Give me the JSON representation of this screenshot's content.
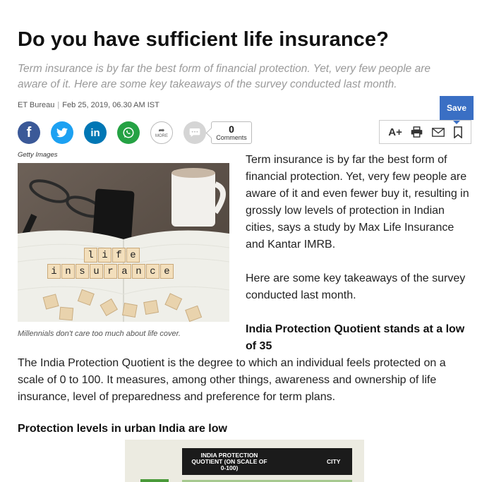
{
  "article": {
    "headline": "Do you have sufficient life insurance?",
    "synopsis": "Term insurance is by far the best form of financial protection. Yet, very few people are aware of it. Here are some key takeaways of the survey conducted last month.",
    "author": "ET Bureau",
    "date": "Feb 25, 2019, 06.30 AM IST"
  },
  "share": {
    "more_label": "MORE",
    "comment_count": "0",
    "comments_label": "Comments",
    "icons": [
      "facebook-icon",
      "twitter-icon",
      "linkedin-icon",
      "whatsapp-icon",
      "share-icon",
      "comment-icon"
    ]
  },
  "toolbar": {
    "save_label": "Save",
    "font_size_label": "A+",
    "icons": [
      "print-icon",
      "email-icon",
      "bookmark-icon"
    ]
  },
  "image": {
    "credit": "Getty Images",
    "caption": "Millennials don't care too much about life cover.",
    "tiles_line1": [
      "l",
      "i",
      "f",
      "e"
    ],
    "tiles_line2": [
      "i",
      "n",
      "s",
      "u",
      "r",
      "a",
      "n",
      "c",
      "e"
    ]
  },
  "body": {
    "p1": "Term insurance is by far the best form of financial protection. Yet, very few people are aware of it and even fewer buy it, resulting in grossly low levels of protection in Indian cities, says a study by Max Life Insurance and Kantar IMRB.",
    "p2": "Here are some key takeaways of the survey conducted last month.",
    "subhead1": "India Protection Quotient stands at a low of 35",
    "p3": "The India Protection Quotient is the degree to which an individual feels protected on a scale of 0 to 100. It measures, among other things, awareness and ownership of life insurance, level of preparedness and preference for term plans.",
    "subhead2": "Protection levels in urban India are low"
  },
  "table": {
    "header_col1": "INDIA PROTECTION QUOTIENT (ON SCALE OF 0-100)",
    "header_col2": "CITY"
  },
  "colors": {
    "facebook": "#3b5998",
    "twitter": "#1da1f2",
    "linkedin": "#0077b5",
    "whatsapp": "#25a244",
    "save": "#3a6fc4"
  }
}
